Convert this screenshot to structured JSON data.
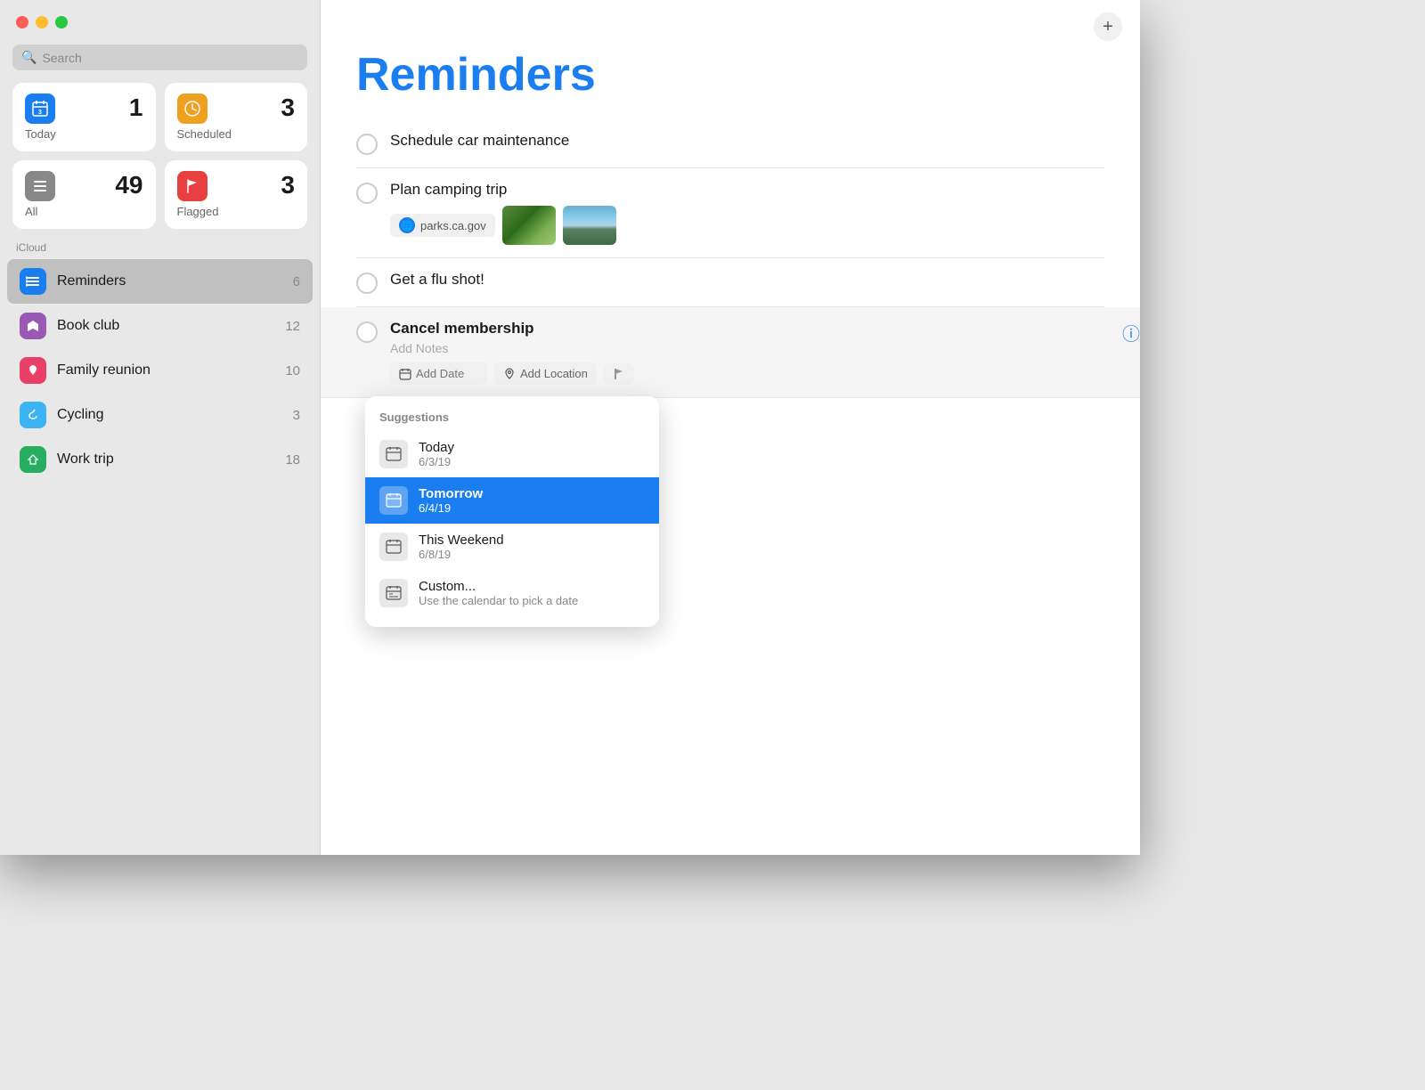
{
  "window": {
    "title": "Reminders"
  },
  "sidebar": {
    "search_placeholder": "Search",
    "icloud_label": "iCloud",
    "smart_cards": [
      {
        "id": "today",
        "label": "Today",
        "count": "1",
        "icon_color": "#1a7df0",
        "icon": "📅"
      },
      {
        "id": "scheduled",
        "label": "Scheduled",
        "count": "3",
        "icon_color": "#f0a020",
        "icon": "🕐"
      },
      {
        "id": "all",
        "label": "All",
        "count": "49",
        "icon_color": "#555",
        "icon": "☰"
      },
      {
        "id": "flagged",
        "label": "Flagged",
        "count": "3",
        "icon_color": "#e84040",
        "icon": "⚑"
      }
    ],
    "lists": [
      {
        "id": "reminders",
        "name": "Reminders",
        "count": "6",
        "icon_color": "#1a7df0",
        "active": true
      },
      {
        "id": "bookclub",
        "name": "Book club",
        "count": "12",
        "icon_color": "#9b59b6"
      },
      {
        "id": "familyreunion",
        "name": "Family reunion",
        "count": "10",
        "icon_color": "#e84067"
      },
      {
        "id": "cycling",
        "name": "Cycling",
        "count": "3",
        "icon_color": "#3ab4f2"
      },
      {
        "id": "worktrip",
        "name": "Work trip",
        "count": "18",
        "icon_color": "#27ae60"
      }
    ]
  },
  "main": {
    "title": "Reminders",
    "add_button_label": "+",
    "reminders": [
      {
        "id": "car",
        "title": "Schedule car maintenance",
        "bold": false,
        "has_attachments": false,
        "active": false
      },
      {
        "id": "camping",
        "title": "Plan camping trip",
        "bold": false,
        "has_attachments": true,
        "link_text": "parks.ca.gov",
        "active": false
      },
      {
        "id": "flu",
        "title": "Get a flu shot!",
        "bold": false,
        "has_attachments": false,
        "active": false
      },
      {
        "id": "membership",
        "title": "Cancel membership",
        "bold": true,
        "notes_placeholder": "Add Notes",
        "date_placeholder": "Add Date",
        "location_placeholder": "Add Location",
        "active": true,
        "show_info": true
      }
    ],
    "date_dropdown": {
      "header": "Suggestions",
      "items": [
        {
          "id": "today",
          "title": "Today",
          "date": "6/3/19",
          "selected": false
        },
        {
          "id": "tomorrow",
          "title": "Tomorrow",
          "date": "6/4/19",
          "selected": true
        },
        {
          "id": "weekend",
          "title": "This Weekend",
          "date": "6/8/19",
          "selected": false
        },
        {
          "id": "custom",
          "title": "Custom...",
          "date": "Use the calendar to pick a date",
          "selected": false
        }
      ]
    }
  }
}
